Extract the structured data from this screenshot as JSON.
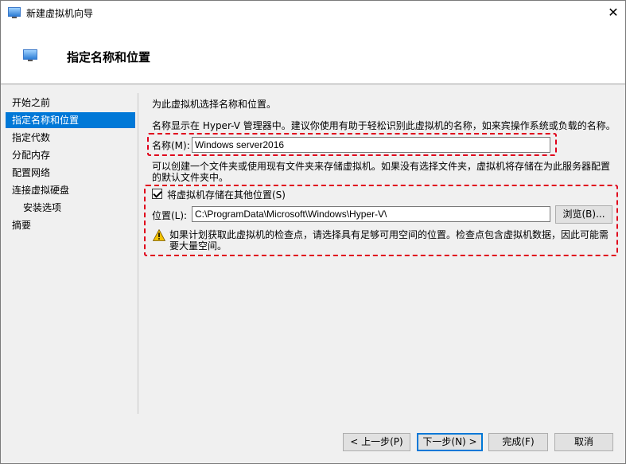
{
  "window": {
    "title": "新建虚拟机向导",
    "close_glyph": "✕"
  },
  "header": {
    "title": "指定名称和位置"
  },
  "sidebar": {
    "items": [
      {
        "label": "开始之前"
      },
      {
        "label": "指定名称和位置"
      },
      {
        "label": "指定代数"
      },
      {
        "label": "分配内存"
      },
      {
        "label": "配置网络"
      },
      {
        "label": "连接虚拟硬盘"
      },
      {
        "label": "安装选项"
      },
      {
        "label": "摘要"
      }
    ]
  },
  "main": {
    "intro": "为此虚拟机选择名称和位置。",
    "name_help": "名称显示在 Hyper-V 管理器中。建议你使用有助于轻松识别此虚拟机的名称，如来宾操作系统或负载的名称。",
    "name_label": "名称(M):",
    "name_value": "Windows server2016",
    "folder_help": "可以创建一个文件夹或使用现有文件夹来存储虚拟机。如果没有选择文件夹，虚拟机将存储在为此服务器配置的默认文件夹中。",
    "store_checkbox_label": "将虚拟机存储在其他位置(S)",
    "store_checked": true,
    "location_label": "位置(L):",
    "location_value": "C:\\ProgramData\\Microsoft\\Windows\\Hyper-V\\",
    "browse_label": "浏览(B)...",
    "warning_text": "如果计划获取此虚拟机的检查点，请选择具有足够可用空间的位置。检查点包含虚拟机数据，因此可能需要大量空间。"
  },
  "footer": {
    "prev_label": "< 上一步(P)",
    "next_label": "下一步(N) >",
    "finish_label": "完成(F)",
    "cancel_label": "取消"
  },
  "colors": {
    "selection": "#0078d7",
    "annotation": "#e0001b",
    "warning": "#f2c200"
  }
}
